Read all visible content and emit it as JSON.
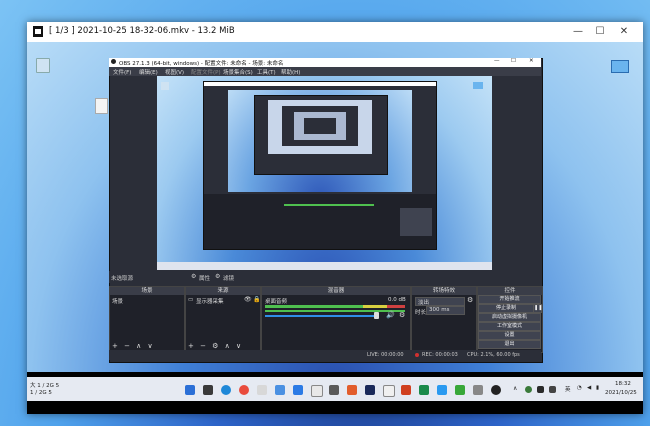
{
  "mpv": {
    "title": "[ 1/3 ] 2021-10-25 18-32-06.mkv - 13.2 MiB",
    "controls": [
      "—",
      "☐",
      "✕"
    ]
  },
  "desktop_icons": {
    "recycle": "Recycle Bin",
    "doc": "新建文本文档"
  },
  "obs": {
    "title": "OBS 27.1.3 (64-bit, windows) - 配置文件: 未命名 - 场景: 未命名",
    "menu": [
      "文件(F)",
      "编辑(E)",
      "视图(V)",
      "配置文件(P)",
      "场景集合(S)",
      "工具(T)",
      "帮助(H)"
    ],
    "scene_bar": {
      "label": "未选取源",
      "props": "属性",
      "filters": "滤镜"
    },
    "docks": {
      "scenes": {
        "header": "场景",
        "item": "场景"
      },
      "sources": {
        "header": "来源",
        "item": "显示器采集"
      },
      "mixer": {
        "header": "混音器",
        "track": "桌面音频",
        "db": "0.0 dB"
      },
      "transitions": {
        "header": "转场特效",
        "type": "淡出",
        "duration_label": "时长",
        "duration": "300 ms"
      },
      "controls": {
        "header": "控件",
        "buttons": [
          "开始推流",
          "停止录制",
          "启动虚拟摄像机",
          "工作室模式",
          "设置",
          "退出"
        ]
      }
    },
    "status": {
      "live": "LIVE: 00:00:00",
      "rec": "REC: 00:00:03",
      "cpu": "CPU: 2.1%, 60.00 fps"
    }
  },
  "tray": {
    "lang": "英",
    "time": "18:32",
    "date": "2021/10/25"
  },
  "taskbar_left": {
    "line1": "大 1 / 2G 5",
    "line2": "1 / 2G 5"
  },
  "colors": {
    "accent": "#1a6fd0",
    "obs_bg": "#2b2e38",
    "vol_green": "#4fc04f",
    "vol_yellow": "#d8d040",
    "vol_red": "#d04040"
  }
}
